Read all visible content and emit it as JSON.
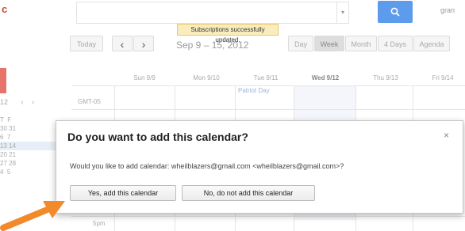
{
  "header": {
    "logo_fragment": "c",
    "search_placeholder": "",
    "search_dropdown_icon": "▾",
    "search_icon": "🔍",
    "user": "gran"
  },
  "notification": {
    "text": "Subscriptions successfully updated."
  },
  "toolbar": {
    "today_label": "Today",
    "prev_label": "‹",
    "next_label": "›",
    "date_range": "Sep 9 – 15, 2012",
    "views": [
      "Day",
      "Week",
      "Month",
      "4 Days",
      "Agenda"
    ],
    "active_view": "Week"
  },
  "mini_calendar": {
    "month_fragment": "12",
    "prev": "‹",
    "next": "›",
    "day_initials": [
      "T",
      "F"
    ],
    "rows": [
      [
        "30",
        "31"
      ],
      [
        "6",
        "7"
      ],
      [
        "13",
        "14"
      ],
      [
        "20",
        "21"
      ],
      [
        "27",
        "28"
      ],
      [
        "4",
        "5"
      ]
    ]
  },
  "calendar_grid": {
    "timezone": "GMT-05",
    "days": [
      "Sun 9/9",
      "Mon 9/10",
      "Tue 9/11",
      "Wed 9/12",
      "Thu 9/13",
      "Fri 9/14"
    ],
    "today": "Wed 9/12",
    "all_day_event": "Patriot Day",
    "time_label": "5pm"
  },
  "dialog": {
    "title": "Do you want to add this calendar?",
    "close_label": "×",
    "message": "Would you like to add calendar: wheilblazers@gmail.com <wheilblazers@gmail.com>?",
    "yes_label": "Yes, add this calendar",
    "no_label": "No, do not add this calendar"
  },
  "colors": {
    "accent": "#5d9cec",
    "banner_bg": "#f9edbe",
    "create_button": "#e7746a",
    "arrow": "#f28a2c"
  }
}
